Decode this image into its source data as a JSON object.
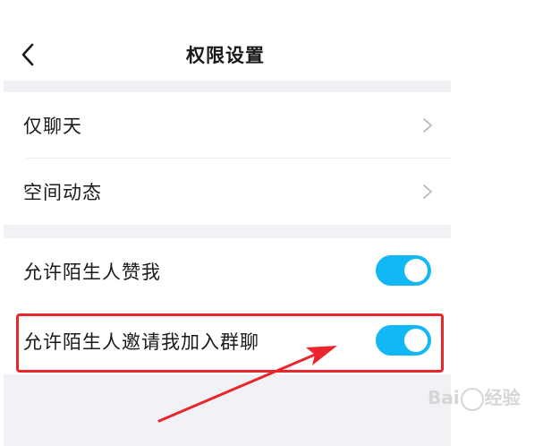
{
  "header": {
    "title": "权限设置",
    "back_icon": "chevron-left-icon"
  },
  "sections": [
    {
      "items": [
        {
          "label": "仅聊天",
          "control": "chevron-right-icon"
        },
        {
          "label": "空间动态",
          "control": "chevron-right-icon"
        }
      ]
    },
    {
      "items": [
        {
          "label": "允许陌生人赞我",
          "control": "toggle",
          "on": true
        },
        {
          "label": "允许陌生人邀请我加入群聊",
          "control": "toggle",
          "on": true
        }
      ]
    }
  ],
  "colors": {
    "toggle_on": "#12b7f5",
    "section_gap": "#f2f2f6",
    "annotation_red": "#e8262b"
  },
  "annotation": {
    "type": "red highlight box with arrow",
    "target": "允许陌生人邀请我加入群聊"
  },
  "watermark": {
    "text_prefix": "Bai",
    "text_suffix": "经验"
  }
}
